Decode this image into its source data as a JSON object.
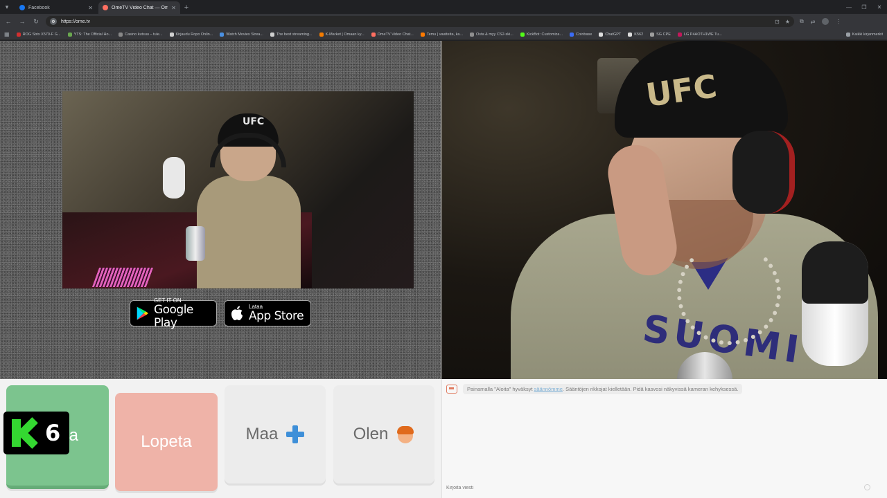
{
  "browser": {
    "tabs": [
      {
        "label": "Facebook",
        "color": "#1877f2",
        "active": false
      },
      {
        "label": "OmeTV Video Chat — Om...",
        "color": "#ff6f61",
        "active": true
      }
    ],
    "address": "https://ome.tv",
    "bookmarks": [
      {
        "label": "ROG Strix X570-F G...",
        "color": "#d32f2f"
      },
      {
        "label": "YTS: The Official Ho...",
        "color": "#6aa84f"
      },
      {
        "label": "Casino kutsuu – tule...",
        "color": "#888888"
      },
      {
        "label": "Kirjaudu Ropo Onlin...",
        "color": "#cfcfcf"
      },
      {
        "label": "Watch Movies Strea...",
        "color": "#4a90e2"
      },
      {
        "label": "The best streaming...",
        "color": "#cfcfcf"
      },
      {
        "label": "K-Market | Omaan ky...",
        "color": "#f57c00"
      },
      {
        "label": "OmeTV Video Chat...",
        "color": "#ff6f61"
      },
      {
        "label": "Temu | vaatteita, ka...",
        "color": "#ff7a00"
      },
      {
        "label": "Osta & myy CS2-ski...",
        "color": "#8f8f8f"
      },
      {
        "label": "KickBot: Customiza...",
        "color": "#53fc18"
      },
      {
        "label": "Coinbase",
        "color": "#3b6cf6"
      },
      {
        "label": "ChatGPT",
        "color": "#dddddd"
      },
      {
        "label": "K562",
        "color": "#dddddd"
      },
      {
        "label": "SG CPE",
        "color": "#9e9e9e"
      },
      {
        "label": "LG P4AOTH1WE Tu...",
        "color": "#c2185b"
      }
    ],
    "all_bookmarks": "Kaikki kirjanmerkit"
  },
  "stores": {
    "google": {
      "small": "GET IT ON",
      "big": "Google Play"
    },
    "apple": {
      "small": "Lataa",
      "big": "App Store"
    }
  },
  "videos": {
    "self_cap": "UFC",
    "remote_cap": "UFC",
    "remote_shirt": "SUOMI"
  },
  "controls": {
    "start": "Aloita",
    "stop": "Lopeta",
    "country": "Maa",
    "gender": "Olen"
  },
  "overlay": {
    "channel_number": "6"
  },
  "chat": {
    "notice_prefix": "Painamalla \"Aloita\" hyväksyt ",
    "notice_link": "säännömme",
    "notice_suffix": ". Sääntöjen rikkojat kielletään. Pidä kasvosi näkyvissä kameran kehyksessä.",
    "input_placeholder": "Kirjoita viesti"
  }
}
